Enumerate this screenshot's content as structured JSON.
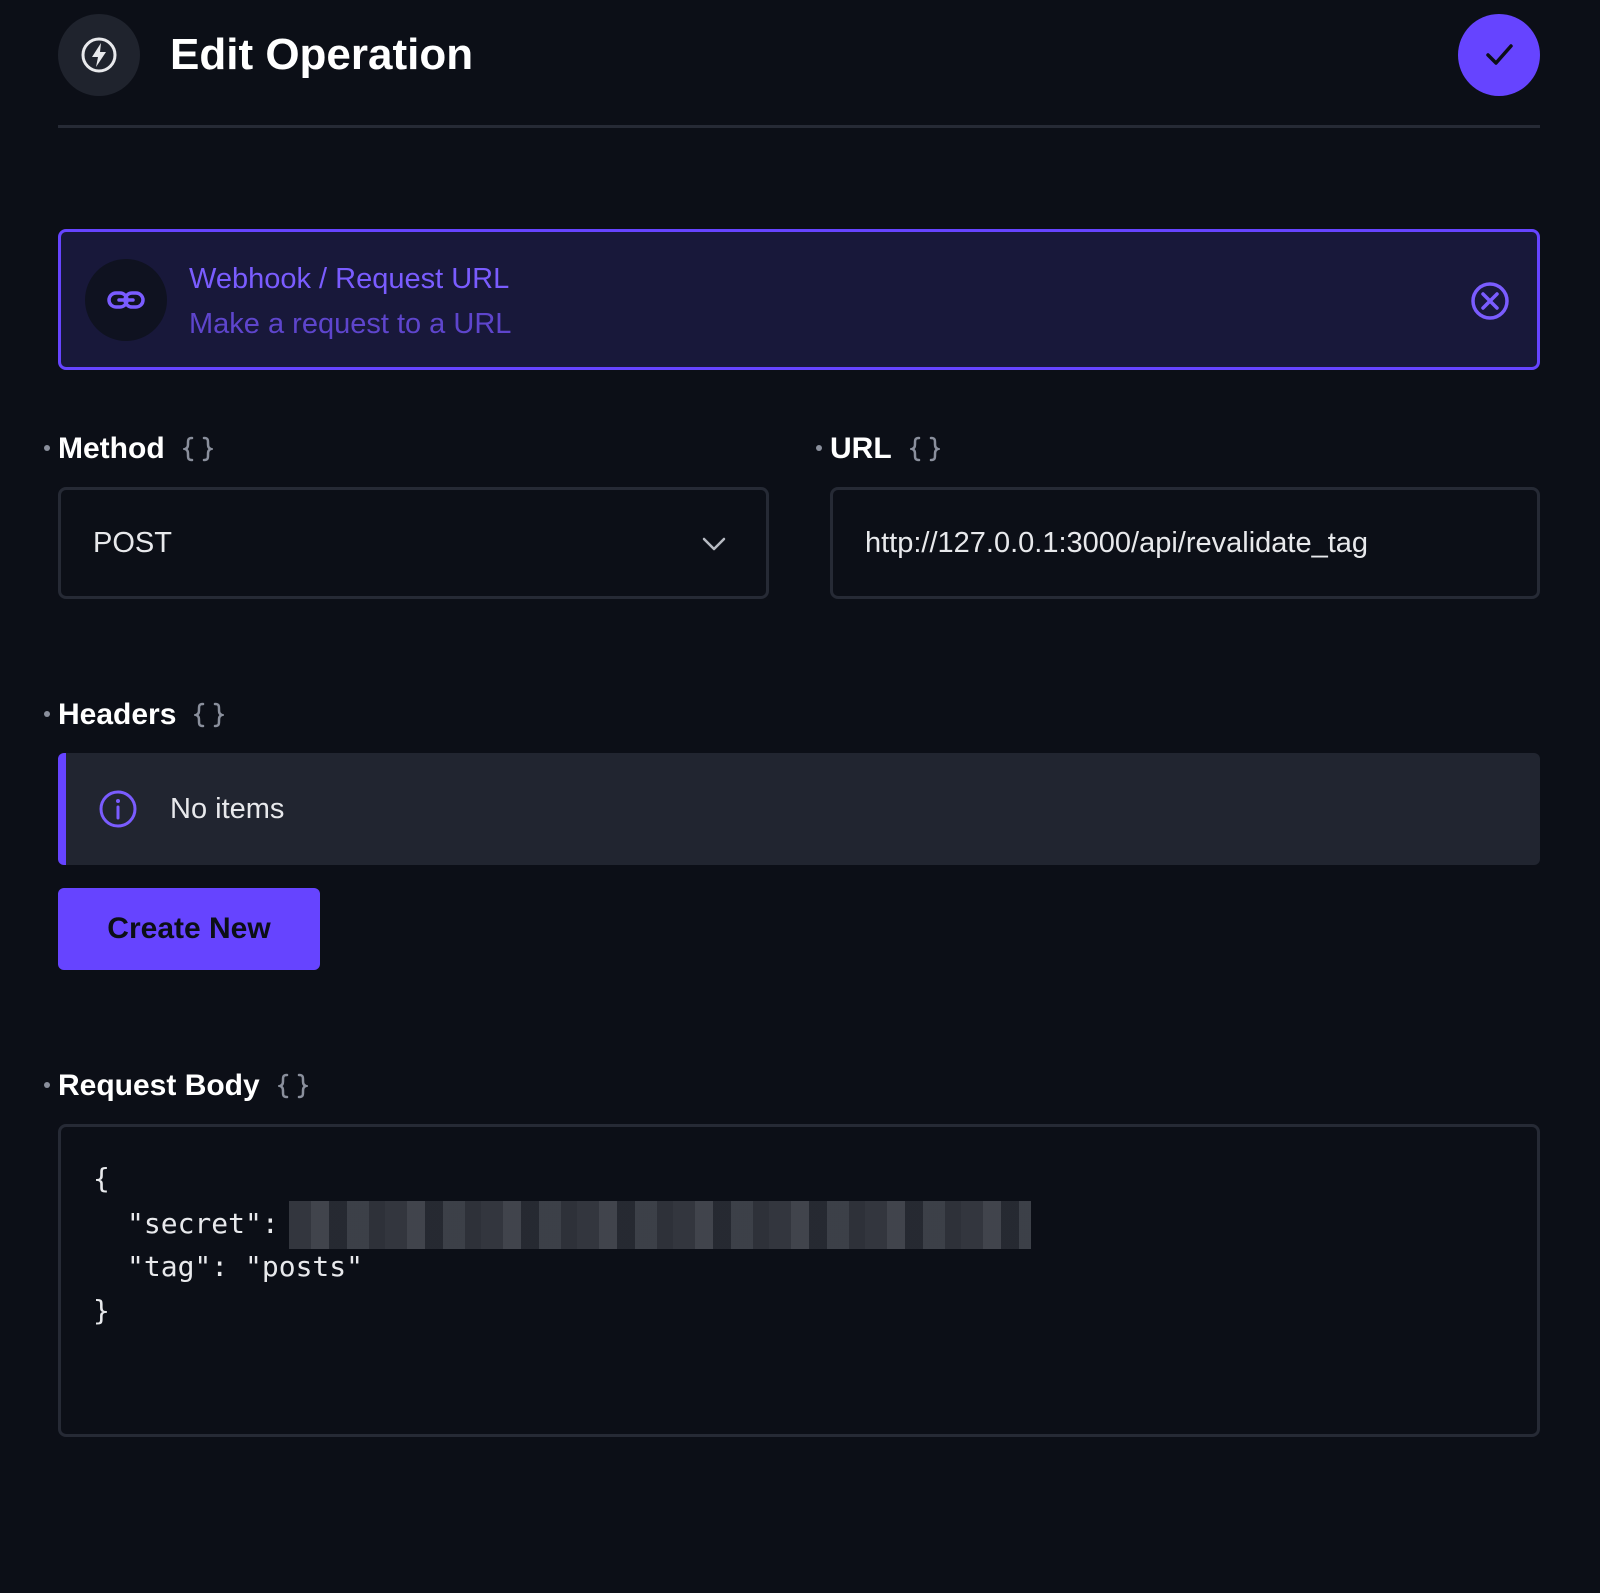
{
  "header": {
    "icon": "bolt-icon",
    "title": "Edit Operation",
    "save_icon": "check-icon"
  },
  "operation": {
    "icon": "link-icon",
    "title": "Webhook / Request URL",
    "subtitle": "Make a request to a URL",
    "deselect_icon": "close-circle-icon"
  },
  "method": {
    "label": "Method",
    "value": "POST"
  },
  "url": {
    "label": "URL",
    "value": "http://127.0.0.1:3000/api/revalidate_tag"
  },
  "headers": {
    "label": "Headers",
    "empty_text": "No items",
    "create_label": "Create New"
  },
  "request_body": {
    "label": "Request Body",
    "lines": {
      "open": "{",
      "secret_key": "\"secret\":",
      "tag_line": "\"tag\": \"posts\"",
      "close": "}"
    }
  },
  "colors": {
    "accent": "#6644ff",
    "background": "#0c0f17",
    "border": "#262a35"
  }
}
